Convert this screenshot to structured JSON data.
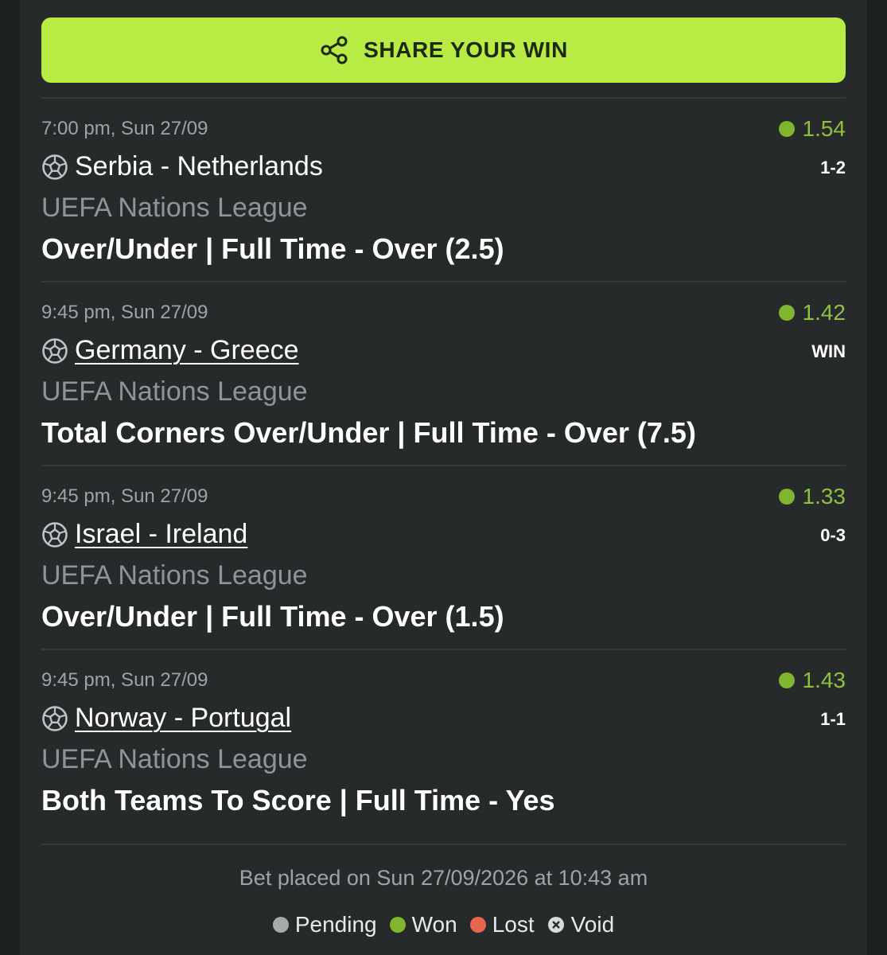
{
  "share_button": {
    "label": "SHARE YOUR WIN",
    "icon": "share-icon"
  },
  "bets": [
    {
      "time": "7:00 pm, Sun 27/09",
      "odds": "1.54",
      "status": "won",
      "teams": "Serbia - Netherlands",
      "linked": false,
      "result": "1-2",
      "league": "UEFA Nations League",
      "market": "Over/Under | Full Time - Over (2.5)"
    },
    {
      "time": "9:45 pm, Sun 27/09",
      "odds": "1.42",
      "status": "won",
      "teams": "Germany - Greece",
      "linked": true,
      "result": "WIN",
      "league": "UEFA Nations League",
      "market": "Total Corners Over/Under | Full Time - Over (7.5)"
    },
    {
      "time": "9:45 pm, Sun 27/09",
      "odds": "1.33",
      "status": "won",
      "teams": "Israel - Ireland",
      "linked": true,
      "result": "0-3",
      "league": "UEFA Nations League",
      "market": "Over/Under | Full Time - Over (1.5)"
    },
    {
      "time": "9:45 pm, Sun 27/09",
      "odds": "1.43",
      "status": "won",
      "teams": "Norway - Portugal",
      "linked": true,
      "result": "1-1",
      "league": "UEFA Nations League",
      "market": "Both Teams To Score | Full Time - Yes"
    }
  ],
  "footer": {
    "placed_text": "Bet placed on Sun 27/09/2026 at 10:43 am",
    "legend": [
      {
        "label": "Pending",
        "color": "#a7a9aa"
      },
      {
        "label": "Won",
        "color": "#7fb52f"
      },
      {
        "label": "Lost",
        "color": "#e8664f"
      },
      {
        "label": "Void",
        "icon": "void-icon"
      }
    ]
  },
  "colors": {
    "accent": "#b8ec45",
    "won": "#7fb52f",
    "background": "#272a2b"
  }
}
